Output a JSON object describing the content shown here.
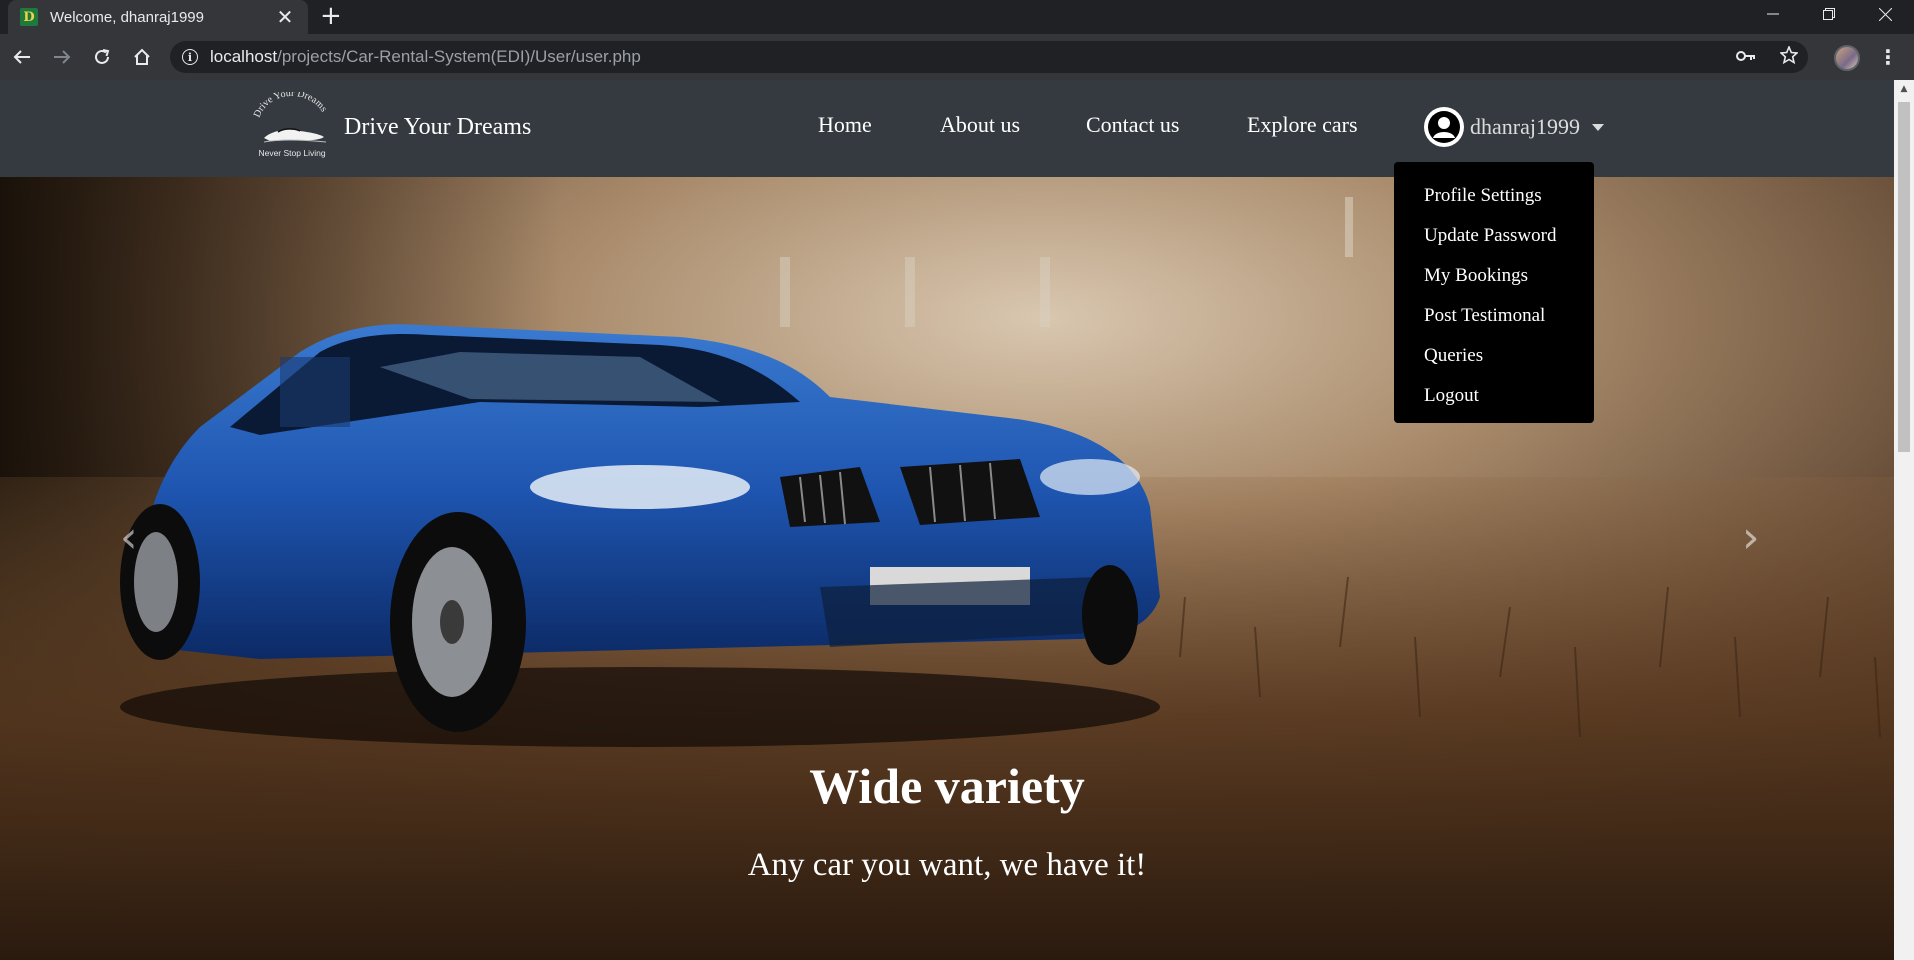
{
  "browser": {
    "tab_title": "Welcome, dhanraj1999",
    "favicon_letter": "D",
    "url_host": "localhost",
    "url_path": "/projects/Car-Rental-System(EDI)/User/user.php"
  },
  "site": {
    "brand_name": "Drive Your Dreams",
    "logo_text_top": "Drive Your Dreams",
    "logo_text_bottom": "Never Stop Living",
    "nav": {
      "home": "Home",
      "about": "About us",
      "contact": "Contact us",
      "explore": "Explore cars"
    },
    "user": {
      "username": "dhanraj1999"
    },
    "dropdown": {
      "profile_settings": "Profile Settings",
      "update_password": "Update Password",
      "my_bookings": "My Bookings",
      "post_testimonal": "Post Testimonal",
      "queries": "Queries",
      "logout": "Logout"
    }
  },
  "carousel": {
    "caption_title": "Wide variety",
    "caption_text": "Any car you want, we have it!",
    "slide_count": 4,
    "active_index": 0
  },
  "colors": {
    "navbar_bg": "#343a40",
    "dropdown_bg": "#000000",
    "car_body": "#1e55b0"
  }
}
